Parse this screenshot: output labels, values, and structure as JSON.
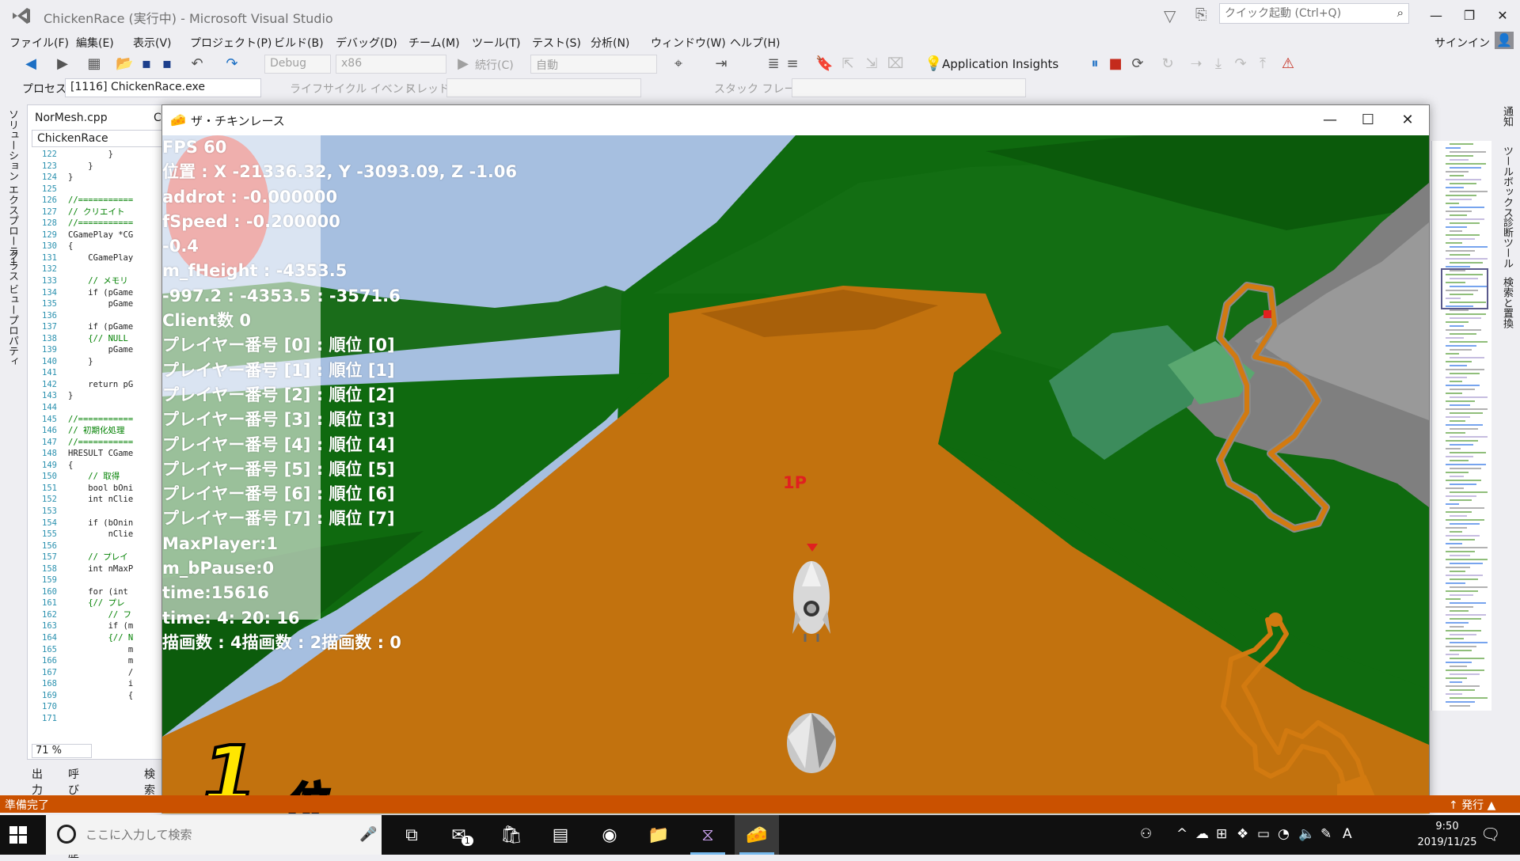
{
  "vs": {
    "title": "ChickenRace (実行中) - Microsoft Visual Studio",
    "quick_launch_placeholder": "クイック起動 (Ctrl+Q)",
    "menu": [
      "ファイル(F)",
      "編集(E)",
      "表示(V)",
      "プロジェクト(P)",
      "ビルド(B)",
      "デバッグ(D)",
      "チーム(M)",
      "ツール(T)",
      "テスト(S)",
      "分析(N)",
      "ウィンドウ(W)",
      "ヘルプ(H)"
    ],
    "signin": "サインイン",
    "toolbar": {
      "config": "Debug",
      "platform": "x86",
      "continue": "続行(C)",
      "auto": "自動",
      "insights": "Application Insights"
    },
    "process": {
      "label": "プロセス",
      "value": "[1116] ChickenRace.exe",
      "lifecycle": "ライフサイクル イベント",
      "thread": "スレッド",
      "stack_frame": "スタック フレーム"
    },
    "left_tabs": [
      "ソリューション エクスプローラー",
      "クラス ビュー",
      "プロパティ"
    ],
    "right_tabs": [
      "通知",
      "ツールボックス",
      "診断ツール",
      "検索と置換"
    ],
    "editor": {
      "tab1": "NorMesh.cpp",
      "tab2": "C",
      "combo": "ChickenRace",
      "zoom": "71 %",
      "lines": [
        {
          "n": "122",
          "t": "        }"
        },
        {
          "n": "123",
          "t": "    }"
        },
        {
          "n": "124",
          "t": "}"
        },
        {
          "n": "125",
          "t": ""
        },
        {
          "n": "126",
          "t": "//===========",
          "c": "cm"
        },
        {
          "n": "127",
          "t": "// クリエイト",
          "c": "cm"
        },
        {
          "n": "128",
          "t": "//===========",
          "c": "cm"
        },
        {
          "n": "129",
          "t": "CGamePlay *CG"
        },
        {
          "n": "130",
          "t": "{"
        },
        {
          "n": "131",
          "t": "    CGamePlay"
        },
        {
          "n": "132",
          "t": ""
        },
        {
          "n": "133",
          "t": "    // メモリ",
          "c": "cm"
        },
        {
          "n": "134",
          "t": "    if (pGame"
        },
        {
          "n": "135",
          "t": "        pGame"
        },
        {
          "n": "136",
          "t": ""
        },
        {
          "n": "137",
          "t": "    if (pGame"
        },
        {
          "n": "138",
          "t": "    {// NULL",
          "c": "cm"
        },
        {
          "n": "139",
          "t": "        pGame"
        },
        {
          "n": "140",
          "t": "    }"
        },
        {
          "n": "141",
          "t": ""
        },
        {
          "n": "142",
          "t": "    return pG"
        },
        {
          "n": "143",
          "t": "}"
        },
        {
          "n": "144",
          "t": ""
        },
        {
          "n": "145",
          "t": "//===========",
          "c": "cm"
        },
        {
          "n": "146",
          "t": "// 初期化処理",
          "c": "cm"
        },
        {
          "n": "147",
          "t": "//===========",
          "c": "cm"
        },
        {
          "n": "148",
          "t": "HRESULT CGame"
        },
        {
          "n": "149",
          "t": "{"
        },
        {
          "n": "150",
          "t": "    // 取得",
          "c": "cm"
        },
        {
          "n": "151",
          "t": "    bool bOni"
        },
        {
          "n": "152",
          "t": "    int nClie"
        },
        {
          "n": "153",
          "t": ""
        },
        {
          "n": "154",
          "t": "    if (bOnin"
        },
        {
          "n": "155",
          "t": "        nClie"
        },
        {
          "n": "156",
          "t": ""
        },
        {
          "n": "157",
          "t": "    // プレイ",
          "c": "cm"
        },
        {
          "n": "158",
          "t": "    int nMaxP"
        },
        {
          "n": "159",
          "t": ""
        },
        {
          "n": "160",
          "t": "    for (int"
        },
        {
          "n": "161",
          "t": "    {// プレ",
          "c": "cm"
        },
        {
          "n": "162",
          "t": "        // フ",
          "c": "cm"
        },
        {
          "n": "163",
          "t": "        if (m"
        },
        {
          "n": "164",
          "t": "        {// N",
          "c": "cm"
        },
        {
          "n": "165",
          "t": "            m"
        },
        {
          "n": "166",
          "t": "            m"
        },
        {
          "n": "167",
          "t": "            /"
        },
        {
          "n": "168",
          "t": "            i"
        },
        {
          "n": "169",
          "t": "            {"
        },
        {
          "n": "170",
          "t": ""
        },
        {
          "n": "171",
          "t": ""
        }
      ]
    },
    "bottom_tabs": [
      "出力",
      "呼び出し履歴",
      "検索"
    ],
    "status": "準備完了",
    "publish": "↑ 発行 ▲"
  },
  "game": {
    "title": "ザ・チキンレース",
    "debug_lines": [
      "FPS 60",
      "位置 : X -21336.32, Y -3093.09, Z -1.06",
      "addrot : -0.000000",
      "fSpeed : -0.200000",
      "-0.4",
      "m_fHeight : -4353.5",
      "-997.2 : -4353.5 : -3571.6",
      "Client数 0",
      "プレイヤー番号 [0] : 順位 [0]",
      "プレイヤー番号 [1] : 順位 [1]",
      "プレイヤー番号 [2] : 順位 [2]",
      "プレイヤー番号 [3] : 順位 [3]",
      "プレイヤー番号 [4] : 順位 [4]",
      "プレイヤー番号 [5] : 順位 [5]",
      "プレイヤー番号 [6] : 順位 [6]",
      "プレイヤー番号 [7] : 順位 [7]",
      "MaxPlayer:1",
      "m_bPause:0",
      "time:15616",
      "time:  4: 20: 16",
      "描画数 : 4描画数 : 2描画数 : 0"
    ],
    "player_marker": "1P",
    "rank_number": "1",
    "rank_suffix": "位",
    "colors": {
      "road": "#c2720e",
      "grass": "#0f6a0f",
      "sky": "#a6bfe0",
      "map_road": "#d27a10"
    }
  },
  "taskbar": {
    "search_placeholder": "ここに入力して検索",
    "time": "9:50",
    "date": "2019/11/25",
    "ime": "A",
    "mail_badge": "1"
  }
}
